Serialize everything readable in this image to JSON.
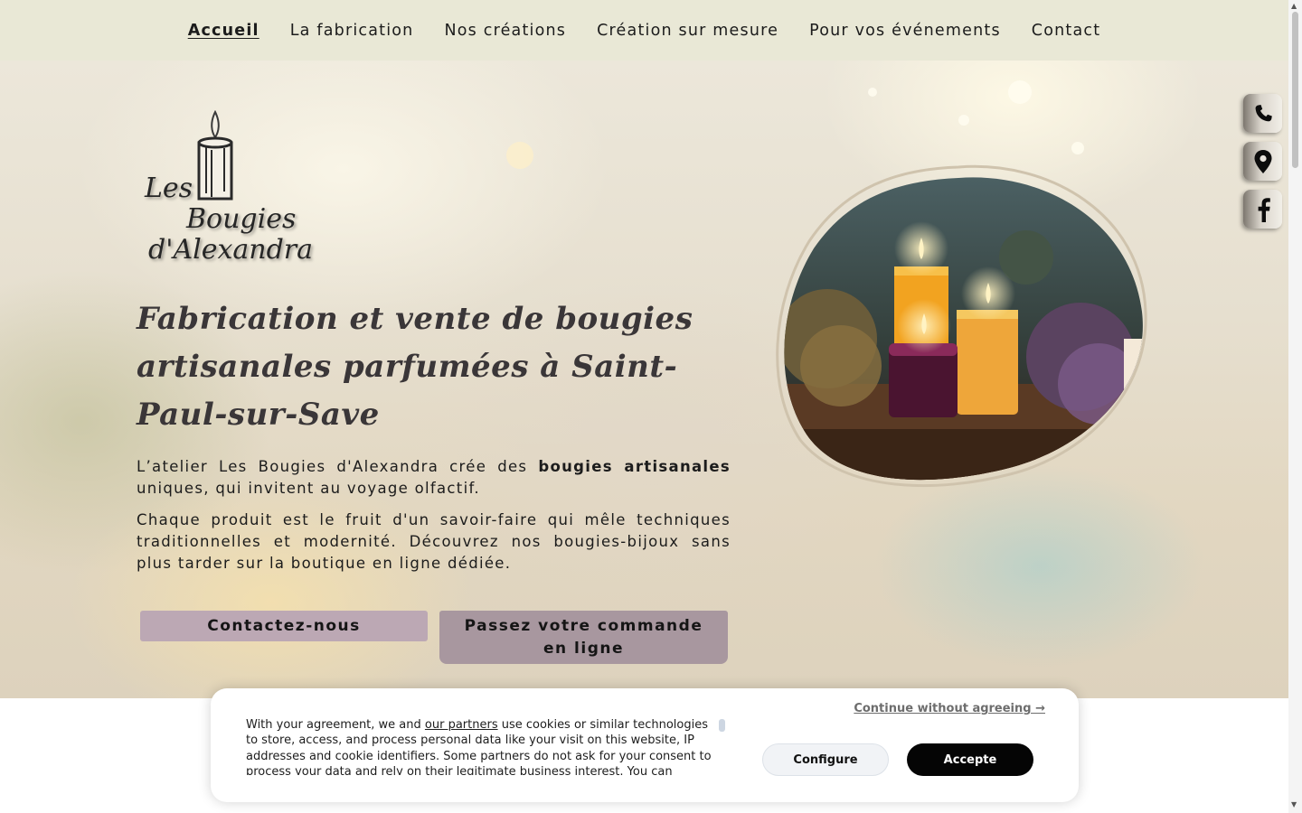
{
  "nav": {
    "items": [
      {
        "label": "Accueil",
        "active": true
      },
      {
        "label": "La fabrication"
      },
      {
        "label": "Nos créations"
      },
      {
        "label": "Création sur mesure"
      },
      {
        "label": "Pour vos événements"
      },
      {
        "label": "Contact"
      }
    ]
  },
  "logo": {
    "line1": "Les",
    "line2": "Bougies",
    "line3": "d'Alexandra"
  },
  "hero": {
    "title": "Fabrication et vente de bougies artisanales parfumées à Saint-Paul-sur-Save",
    "p1_before": "L’atelier Les Bougies d'Alexandra crée des ",
    "p1_strong": "bougies artisanales",
    "p1_after": " uniques, qui invitent au voyage olfactif.",
    "p2": "Chaque produit est le fruit d'un savoir-faire qui mêle techniques traditionnelles et modernité. Découvrez nos bougies-bijoux sans plus tarder sur la boutique en ligne dédiée.",
    "btn_contact": "Contactez-nous",
    "btn_order": "Passez votre commande en ligne"
  },
  "side_icons": [
    "phone-icon",
    "map-pin-icon",
    "facebook-icon"
  ],
  "cookie": {
    "continue": "Continue without agreeing →",
    "text_before": "With your agreement, we and ",
    "text_link": "our partners",
    "text_after": " use cookies or similar technologies to store, access, and process personal data like your visit on this website, IP addresses and cookie identifiers. Some partners do not ask for your consent to process your data and rely on their legitimate business interest. You can",
    "configure": "Configure",
    "accept": "Accepte"
  },
  "colors": {
    "nav_bg": "#e9e8d6",
    "btn_contact": "#bca8b4",
    "btn_order": "#a8979f",
    "accept_bg": "#050505"
  }
}
